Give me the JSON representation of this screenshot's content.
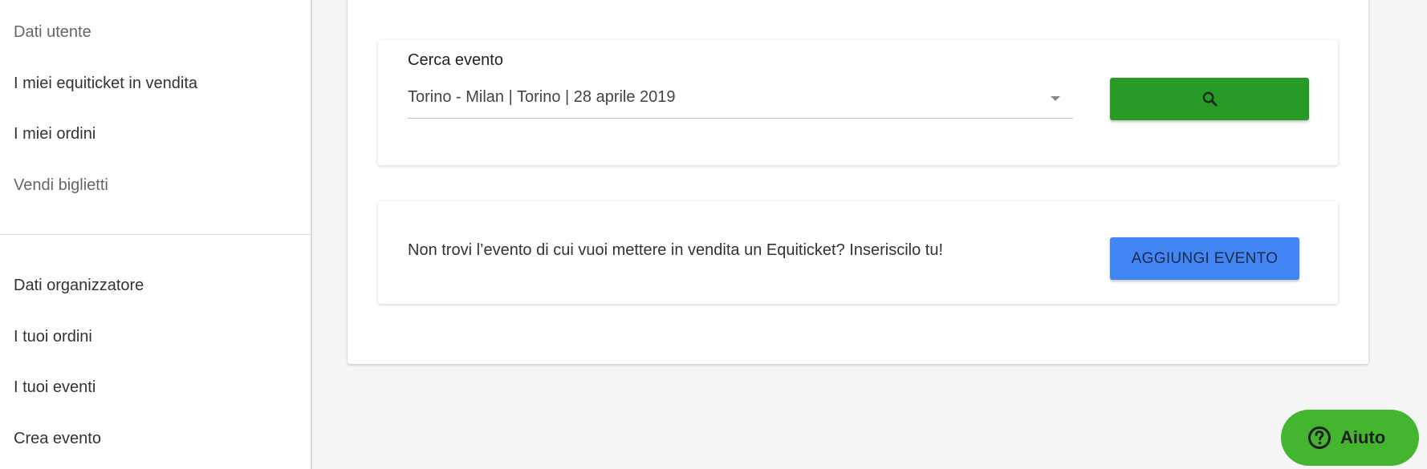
{
  "sidebar": {
    "user_section": [
      {
        "label": "Dati utente"
      },
      {
        "label": "I miei equiticket in vendita"
      },
      {
        "label": "I miei ordini"
      },
      {
        "label": "Vendi biglietti"
      }
    ],
    "organizer_section": [
      {
        "label": "Dati organizzatore"
      },
      {
        "label": "I tuoi ordini"
      },
      {
        "label": "I tuoi eventi"
      },
      {
        "label": "Crea evento"
      }
    ]
  },
  "search": {
    "label": "Cerca evento",
    "selected_event": "Torino - Milan | Torino | 28 aprile 2019",
    "button_icon": "search-icon",
    "button_color": "#279b25"
  },
  "add_event": {
    "prompt": "Non trovi l’evento di cui vuoi mettere in vendita un Equiticket? Inseriscilo tu!",
    "button_label": "AGGIUNGI EVENTO",
    "button_color": "#4285f4"
  },
  "help": {
    "label": "Aiuto",
    "icon": "question-circle-icon",
    "color": "#44b52f"
  }
}
